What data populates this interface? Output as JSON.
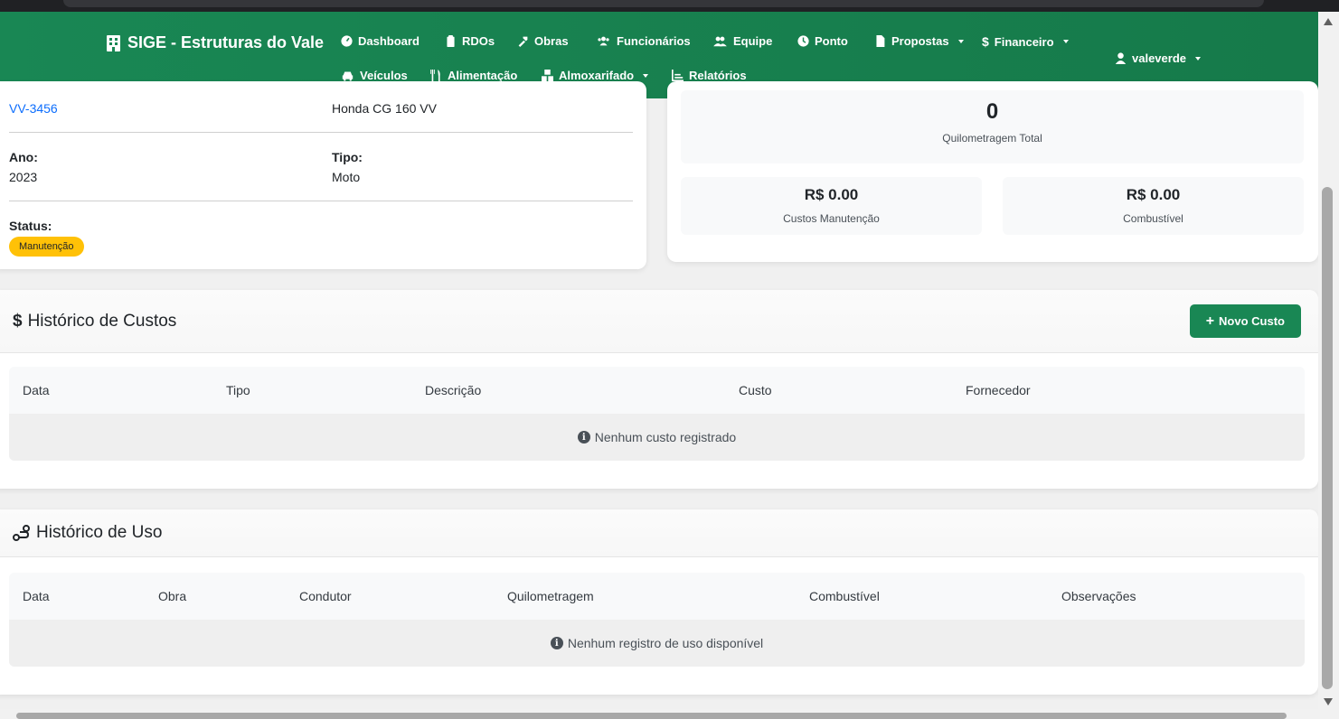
{
  "navbar": {
    "brand": "SIGE - Estruturas do Vale",
    "items": [
      {
        "label": "Dashboard"
      },
      {
        "label": "RDOs"
      },
      {
        "label": "Obras"
      },
      {
        "label": "Funcionários"
      },
      {
        "label": "Equipe"
      },
      {
        "label": "Ponto"
      },
      {
        "label": "Propostas"
      },
      {
        "label": "Financeiro"
      },
      {
        "label": "Veículos"
      },
      {
        "label": "Alimentação"
      },
      {
        "label": "Almoxarifado"
      },
      {
        "label": "Relatórios"
      }
    ],
    "user": "valeverde"
  },
  "vehicle": {
    "plate": "VV-3456",
    "model": "Honda CG 160 VV",
    "year_label": "Ano:",
    "year": "2023",
    "type_label": "Tipo:",
    "type": "Moto",
    "status_label": "Status:",
    "status": "Manutenção",
    "status_color": "#ffc107"
  },
  "stats": {
    "km_total": "0",
    "km_total_label": "Quilometragem Total",
    "maintenance_cost": "R$ 0.00",
    "maintenance_label": "Custos Manutenção",
    "fuel_cost": "R$ 0.00",
    "fuel_label": "Combustível"
  },
  "costs": {
    "title": "Histórico de Custos",
    "new_button": "Novo Custo",
    "columns": [
      "Data",
      "Tipo",
      "Descrição",
      "Custo",
      "Fornecedor"
    ],
    "empty": "Nenhum custo registrado"
  },
  "usage": {
    "title": "Histórico de Uso",
    "columns": [
      "Data",
      "Obra",
      "Condutor",
      "Quilometragem",
      "Combustível",
      "Observações"
    ],
    "empty": "Nenhum registro de uso disponível"
  },
  "colors": {
    "navbar": "#198754",
    "primary_button": "#198754",
    "link": "#0d6efd",
    "warning_badge": "#ffc107"
  }
}
